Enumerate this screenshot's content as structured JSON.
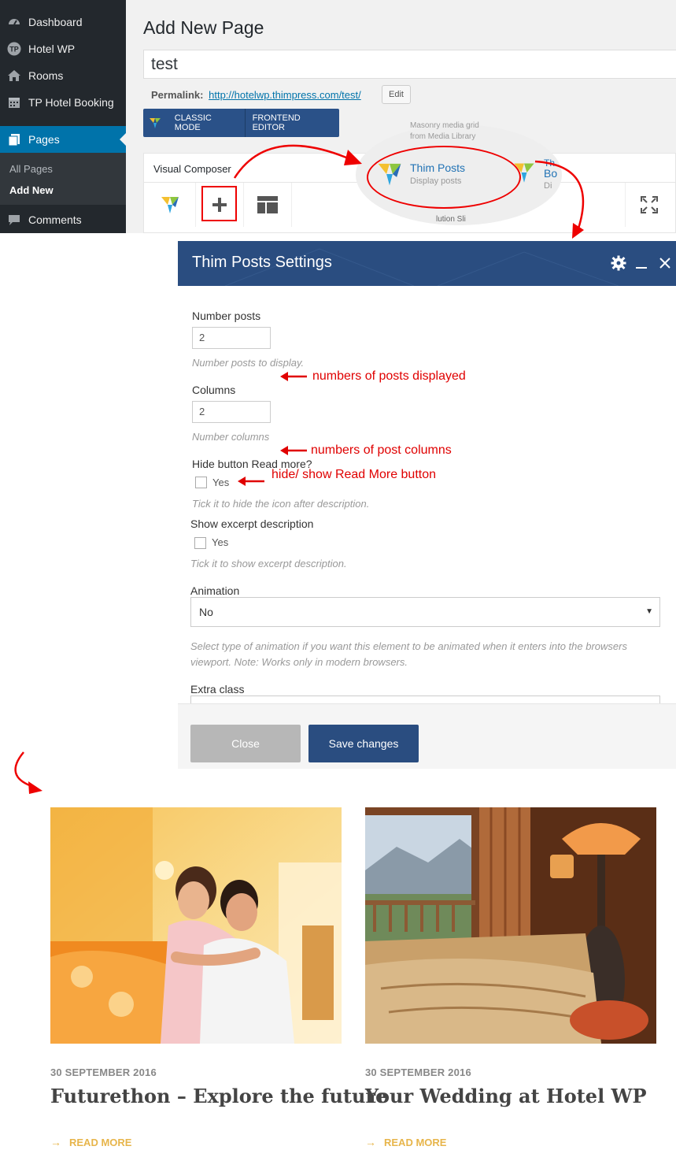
{
  "sidebar": {
    "items": [
      {
        "label": "Dashboard",
        "icon": "dashboard-icon"
      },
      {
        "label": "Hotel WP",
        "icon": "hotel-wp-icon"
      },
      {
        "label": "Rooms",
        "icon": "home-icon"
      },
      {
        "label": "TP Hotel Booking",
        "icon": "calendar-icon"
      },
      {
        "label": "Pages",
        "icon": "pages-icon"
      },
      {
        "label": "Comments",
        "icon": "comments-icon"
      }
    ],
    "submenu": [
      {
        "label": "All Pages"
      },
      {
        "label": "Add New"
      }
    ],
    "accent": "#0073aa"
  },
  "editor": {
    "heading": "Add New Page",
    "title_value": "test",
    "permalink_label": "Permalink:",
    "permalink_url": "http://hotelwp.thimpress.com/test/",
    "edit_label": "Edit",
    "classic_mode": "CLASSIC MODE",
    "frontend_editor": "FRONTEND EDITOR",
    "vc_panel_title": "Visual Composer"
  },
  "element_popup": {
    "ghost_line1": "Masonry media grid",
    "ghost_line2": "from Media Library",
    "title": "Thim Posts",
    "desc": "Display posts",
    "next_line1": "Th",
    "next_line2": "Bo",
    "next_line3": "Di",
    "ghost_bottom": "lution Sli"
  },
  "dialog": {
    "title": "Thim Posts Settings",
    "header_color": "#2a4d80",
    "fields": {
      "number_posts": {
        "label": "Number posts",
        "value": "2",
        "help": "Number posts to display."
      },
      "columns": {
        "label": "Columns",
        "value": "2",
        "help": "Number columns"
      },
      "hide_read_more": {
        "label": "Hide button Read more?",
        "option": "Yes",
        "help": "Tick it to hide the icon after description."
      },
      "show_excerpt": {
        "label": "Show excerpt description",
        "option": "Yes",
        "help": "Tick it to show excerpt description."
      },
      "animation": {
        "label": "Animation",
        "value": "No",
        "help_line1": "Select type of animation if you want this element to be animated when it enters into the browsers",
        "help_line2": "viewport. Note: Works only in modern browsers."
      },
      "extra_class": {
        "label": "Extra class"
      }
    },
    "close_label": "Close",
    "save_label": "Save changes"
  },
  "annotations": {
    "posts_note": "numbers of posts displayed",
    "columns_note": "numbers of post columns",
    "readmore_note": "hide/ show Read More button",
    "color": "#e00000"
  },
  "posts": [
    {
      "date": "30 SEPTEMBER 2016",
      "title": "Futurethon – Explore the future",
      "read_more": "READ MORE"
    },
    {
      "date": "30 SEPTEMBER 2016",
      "title": "Your Wedding at Hotel WP",
      "read_more": "READ MORE"
    }
  ]
}
